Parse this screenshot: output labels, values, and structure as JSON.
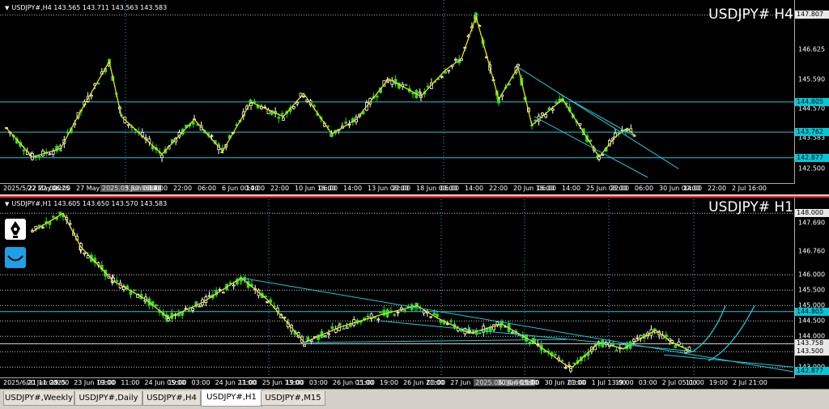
{
  "h4": {
    "header": "USDJPY#,H4  143.565 143.711 143.563 143.583",
    "symbol_label": "USDJPY# H4",
    "price_ticks": [
      "147.807",
      "146.625",
      "145.590",
      "144.570",
      "143.583",
      "142.500"
    ],
    "price_tags": [
      {
        "text": "147.807",
        "style": "white",
        "price": 147.807
      },
      {
        "text": "144.805",
        "style": "cyan",
        "price": 144.805
      },
      {
        "text": "143.762",
        "style": "cyan",
        "price": 143.762
      },
      {
        "text": "142.877",
        "style": "cyan",
        "price": 142.877
      }
    ],
    "time_labels": [
      "2025/5/22 22:00",
      "22 May 2025",
      "06:00",
      "27 May 00:00",
      "2025.05.30 06:00",
      "3 Jun 08:00",
      "14:00",
      "22:00",
      "06:00",
      "6 Jun 00:00",
      "14:00",
      "22:00",
      "10 Jun 16:00",
      "06:00",
      "14:00",
      "13 Jun 08:00",
      "22:00",
      "18 Jun 00:00",
      "06:00",
      "14:00",
      "22:00",
      "20 Jun 16:00",
      "06:00",
      "14:00",
      "25 Jun 08:00",
      "22:00",
      "06:00",
      "30 Jun 00:00",
      "14:00",
      "22:00",
      "2 Jul 16:00"
    ],
    "highlight_time": "2025.05.30 06:00",
    "price_min": 142.2,
    "price_max": 148.1
  },
  "h1": {
    "header": "USDJPY#,H1  143.605 143.650 143.570 143.583",
    "symbol_label": "USDJPY# H1",
    "price_ticks": [
      "148.000",
      "147.690",
      "146.760",
      "146.000",
      "145.500",
      "145.000",
      "144.500",
      "144.000",
      "143.500",
      "143.000"
    ],
    "price_tags": [
      {
        "text": "148.000",
        "style": "white",
        "price": 148.0
      },
      {
        "text": "144.805",
        "style": "cyan",
        "price": 144.805
      },
      {
        "text": "143.758",
        "style": "white",
        "price": 143.758
      },
      {
        "text": "143.500",
        "style": "white",
        "price": 143.5
      },
      {
        "text": "142.877",
        "style": "cyan",
        "price": 142.877
      }
    ],
    "time_labels": [
      "2025/6/21 11:00",
      "20 Jun 2025",
      "19:00",
      "23 Jun 19:00",
      "03:00",
      "11:00",
      "24 Jun 05:00",
      "19:00",
      "03:00",
      "24 Jun 21:00",
      "11:00",
      "25 Jun 13:00",
      "19:00",
      "03:00",
      "26 Jun 05:00",
      "11:00",
      "19:00",
      "26 Jun 21:00",
      "03:00",
      "27 Jun 13:00",
      "2025.06.30 06:00",
      "30 Jun 05:00",
      "11:00",
      "30 Jun 21:00",
      "03:00",
      "1 Jul 13:00",
      "19:00",
      "03:00",
      "2 Jul 05:00",
      "11:00",
      "19:00",
      "2 Jul 21:00"
    ],
    "highlight_time": "2025.06.30 06:00",
    "price_min": 142.85,
    "price_max": 148.35
  },
  "tabs": [
    {
      "label": "USDJPY#,Weekly",
      "active": false
    },
    {
      "label": "USDJPY#,Daily",
      "active": false
    },
    {
      "label": "USDJPY#,H4",
      "active": false
    },
    {
      "label": "USDJPY#,H1",
      "active": true
    },
    {
      "label": "USDJPY#,M15",
      "active": false
    }
  ],
  "colors": {
    "bull": "#ffffff",
    "bear": "#2ad83a",
    "zigzag": "#e6e600",
    "channel": "#22c6d8",
    "grid": "#cfcfcf",
    "background": "#000000"
  }
}
